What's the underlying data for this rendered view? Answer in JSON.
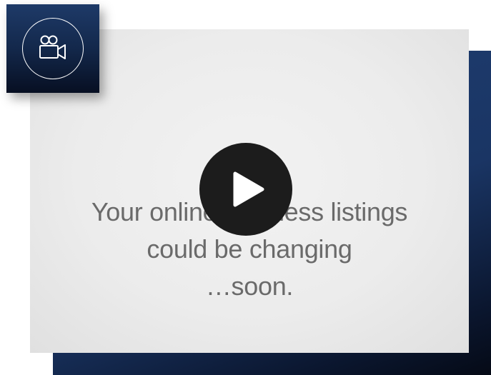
{
  "video": {
    "caption_lines": [
      "Your online business listings",
      "could be changing",
      "…soon."
    ],
    "play_icon": "play-icon"
  },
  "badge": {
    "icon": "video-camera-icon"
  },
  "colors": {
    "navy": "#1a3564",
    "play_button": "#1c1c1c",
    "caption": "#6a6a6a"
  }
}
